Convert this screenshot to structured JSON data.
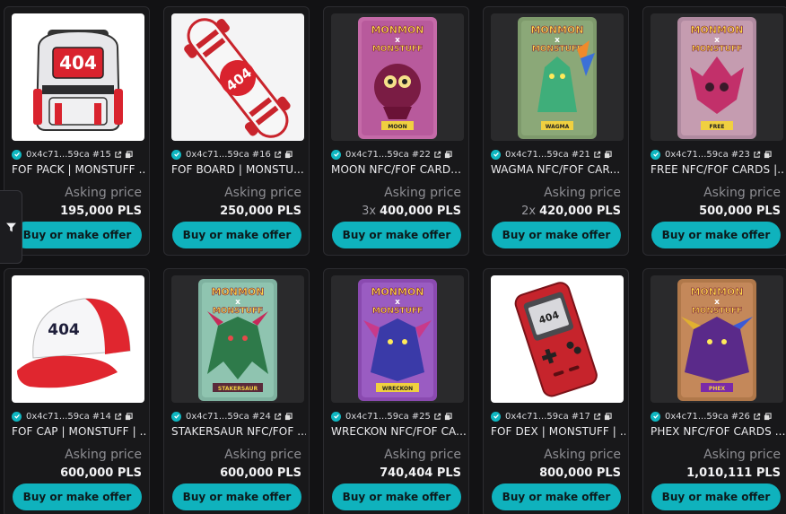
{
  "accent": "#0fb2bd",
  "filter": {
    "icon": "filter-icon"
  },
  "cards": [
    {
      "owner": "0x4c71...59ca",
      "token": "#15",
      "title": "FOF PACK | MONSTUFF ...",
      "asking": "Asking price",
      "qty": "",
      "price": "195,000 PLS",
      "button": "Buy or make offer",
      "art": "backpack"
    },
    {
      "owner": "0x4c71...59ca",
      "token": "#16",
      "title": "FOF BOARD | MONSTU...",
      "asking": "Asking price",
      "qty": "",
      "price": "250,000 PLS",
      "button": "Buy or make offer",
      "art": "skateboard"
    },
    {
      "owner": "0x4c71...59ca",
      "token": "#22",
      "title": "MOON NFC/FOF CARD...",
      "asking": "Asking price",
      "qty": "3x",
      "price": "400,000 PLS",
      "button": "Buy or make offer",
      "art": "card-moon"
    },
    {
      "owner": "0x4c71...59ca",
      "token": "#21",
      "title": "WAGMA NFC/FOF CAR...",
      "asking": "Asking price",
      "qty": "2x",
      "price": "420,000 PLS",
      "button": "Buy or make offer",
      "art": "card-wagma"
    },
    {
      "owner": "0x4c71...59ca",
      "token": "#23",
      "title": "FREE NFC/FOF CARDS |...",
      "asking": "Asking price",
      "qty": "",
      "price": "500,000 PLS",
      "button": "Buy or make offer",
      "art": "card-free"
    },
    {
      "owner": "0x4c71...59ca",
      "token": "#14",
      "title": "FOF CAP | MONSTUFF | ...",
      "asking": "Asking price",
      "qty": "",
      "price": "600,000 PLS",
      "button": "Buy or make offer",
      "art": "cap"
    },
    {
      "owner": "0x4c71...59ca",
      "token": "#24",
      "title": "STAKERSAUR NFC/FOF ...",
      "asking": "Asking price",
      "qty": "",
      "price": "600,000 PLS",
      "button": "Buy or make offer",
      "art": "card-stakersaur"
    },
    {
      "owner": "0x4c71...59ca",
      "token": "#25",
      "title": "WRECKON NFC/FOF CA...",
      "asking": "Asking price",
      "qty": "",
      "price": "740,404 PLS",
      "button": "Buy or make offer",
      "art": "card-wreckon"
    },
    {
      "owner": "0x4c71...59ca",
      "token": "#17",
      "title": "FOF DEX | MONSTUFF | ...",
      "asking": "Asking price",
      "qty": "",
      "price": "800,000 PLS",
      "button": "Buy or make offer",
      "art": "dex"
    },
    {
      "owner": "0x4c71...59ca",
      "token": "#26",
      "title": "PHEX NFC/FOF CARDS ...",
      "asking": "Asking price",
      "qty": "",
      "price": "1,010,111 PLS",
      "button": "Buy or make offer",
      "art": "card-phex"
    }
  ],
  "art_text": {
    "backpack": "404",
    "skateboard": "404",
    "cap": "404",
    "dex": "404",
    "card_header_1": "MONMON",
    "card_header_2": "x",
    "card_header_3": "MONSTUFF",
    "card-moon": "MOON",
    "card-wagma": "WAGMA",
    "card-free": "FREE",
    "card-stakersaur": "STAKERSAUR",
    "card-wreckon": "WRECKON",
    "card-phex": "PHEX"
  }
}
